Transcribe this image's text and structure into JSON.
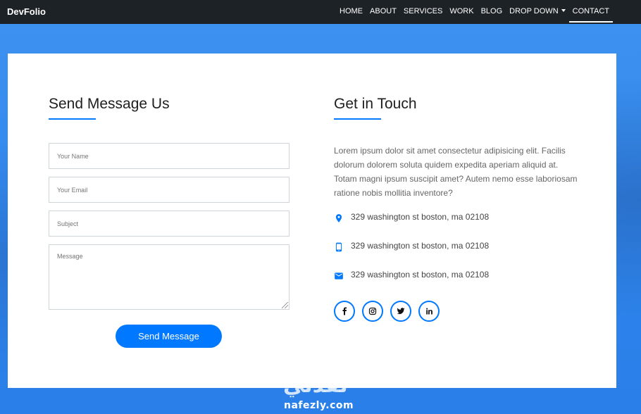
{
  "navbar": {
    "brand": "DevFolio",
    "items": [
      {
        "label": "HOME"
      },
      {
        "label": "ABOUT"
      },
      {
        "label": "SERVICES"
      },
      {
        "label": "WORK"
      },
      {
        "label": "BLOG"
      },
      {
        "label": "DROP DOWN"
      },
      {
        "label": "CONTACT"
      }
    ],
    "active": "CONTACT"
  },
  "form": {
    "title": "Send Message Us",
    "name_placeholder": "Your Name",
    "email_placeholder": "Your Email",
    "subject_placeholder": "Subject",
    "message_placeholder": "Message",
    "submit_label": "Send Message"
  },
  "contact": {
    "title": "Get in Touch",
    "description": "Lorem ipsum dolor sit amet consectetur adipisicing elit. Facilis dolorum dolorem soluta quidem expedita aperiam aliquid at. Totam magni ipsum suscipit amet? Autem nemo esse laboriosam ratione nobis mollitia inventore?",
    "info": [
      {
        "icon": "location-pin-icon",
        "text": "329 washington st boston, ma 02108"
      },
      {
        "icon": "mobile-phone-icon",
        "text": "329 washington st boston, ma 02108"
      },
      {
        "icon": "envelope-icon",
        "text": "329 washington st boston, ma 02108"
      }
    ],
    "social": [
      "facebook-icon",
      "instagram-icon",
      "twitter-icon",
      "linkedin-icon"
    ]
  },
  "watermark": {
    "arabic": "نفذلي",
    "latin": "nafezly.com"
  },
  "colors": {
    "accent": "#0078ff",
    "navbar": "#1d2227",
    "background": "#2f86ec"
  }
}
